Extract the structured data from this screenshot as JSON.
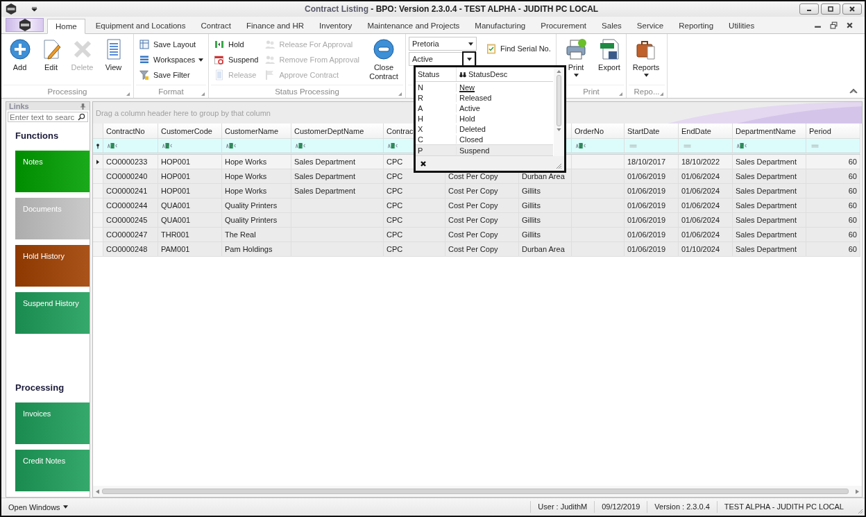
{
  "window": {
    "document_title": "Contract Listing",
    "app_title": "- BPO: Version 2.3.0.4 - TEST ALPHA - JUDITH PC LOCAL"
  },
  "tabs": [
    {
      "label": "Home",
      "selected": true
    },
    {
      "label": "Equipment and Locations",
      "selected": false
    },
    {
      "label": "Contract",
      "selected": false
    },
    {
      "label": "Finance and HR",
      "selected": false
    },
    {
      "label": "Inventory",
      "selected": false
    },
    {
      "label": "Maintenance and Projects",
      "selected": false
    },
    {
      "label": "Manufacturing",
      "selected": false
    },
    {
      "label": "Procurement",
      "selected": false
    },
    {
      "label": "Sales",
      "selected": false
    },
    {
      "label": "Service",
      "selected": false
    },
    {
      "label": "Reporting",
      "selected": false
    },
    {
      "label": "Utilities",
      "selected": false
    }
  ],
  "ribbon": {
    "groups": [
      {
        "label": "Processing",
        "items": [
          {
            "kind": "large",
            "label": "Add",
            "disabled": false
          },
          {
            "kind": "large",
            "label": "Edit",
            "disabled": false
          },
          {
            "kind": "large",
            "label": "Delete",
            "disabled": true
          },
          {
            "kind": "large",
            "label": "View",
            "disabled": false
          }
        ]
      },
      {
        "label": "Format",
        "items": [
          {
            "kind": "small",
            "label": "Save Layout",
            "disabled": false
          },
          {
            "kind": "small",
            "label": "Workspaces",
            "disabled": false,
            "dropdown": true
          },
          {
            "kind": "small",
            "label": "Save Filter",
            "disabled": false
          }
        ]
      },
      {
        "label": "Status Processing",
        "items": [
          {
            "kind": "small",
            "label": "Hold",
            "disabled": false
          },
          {
            "kind": "small",
            "label": "Suspend",
            "disabled": false
          },
          {
            "kind": "small",
            "label": "Release",
            "disabled": true
          },
          {
            "kind": "small",
            "label": "Release For Approval",
            "disabled": true
          },
          {
            "kind": "small",
            "label": "Remove From Approval",
            "disabled": true
          },
          {
            "kind": "small",
            "label": "Approve Contract",
            "disabled": true
          },
          {
            "kind": "large",
            "label": "Close Contract",
            "disabled": false
          }
        ]
      },
      {
        "items": [
          {
            "kind": "combo",
            "value": "Pretoria",
            "open": false
          },
          {
            "kind": "combo",
            "value": "Active",
            "open": true
          },
          {
            "kind": "small",
            "label": "Find Serial No."
          }
        ]
      },
      {
        "label": "Print",
        "items": [
          {
            "kind": "large",
            "label": "Print",
            "disabled": false,
            "dropdown": true
          },
          {
            "kind": "large",
            "label": "Export",
            "disabled": false
          }
        ]
      },
      {
        "label": "Repo...",
        "items": [
          {
            "kind": "large",
            "label": "Reports",
            "disabled": false,
            "dropdown": true
          }
        ]
      }
    ]
  },
  "status_dropdown": {
    "columns": [
      "Status",
      "StatusDesc"
    ],
    "rows": [
      {
        "code": "N",
        "desc": "New",
        "selected": false,
        "hovered": true
      },
      {
        "code": "R",
        "desc": "Released",
        "selected": false,
        "hovered": false
      },
      {
        "code": "A",
        "desc": "Active",
        "selected": false,
        "hovered": false
      },
      {
        "code": "H",
        "desc": "Hold",
        "selected": false,
        "hovered": false
      },
      {
        "code": "X",
        "desc": "Deleted",
        "selected": false,
        "hovered": false
      },
      {
        "code": "C",
        "desc": "Closed",
        "selected": false,
        "hovered": false
      },
      {
        "code": "P",
        "desc": "Suspend",
        "selected": true,
        "hovered": false
      }
    ]
  },
  "sidebar": {
    "title": "Links",
    "search_placeholder": "Enter text to searc",
    "sections": [
      {
        "heading": "Functions",
        "tiles": [
          {
            "label": "Notes",
            "color": "#00a000"
          },
          {
            "label": "Documents",
            "color": "#c4c4c4"
          },
          {
            "label": "Hold History",
            "color": "#a04000"
          },
          {
            "label": "Suspend History",
            "color": "#1e9e5a"
          }
        ]
      },
      {
        "heading": "Processing",
        "tiles": [
          {
            "label": "Invoices",
            "color": "#1e9e5a"
          },
          {
            "label": "Credit Notes",
            "color": "#1e9e5a"
          }
        ]
      }
    ]
  },
  "grid": {
    "group_panel_hint": "Drag a column header here to group by that column",
    "columns": [
      {
        "header": "ContractNo",
        "kind": "text"
      },
      {
        "header": "CustomerCode",
        "kind": "text"
      },
      {
        "header": "CustomerName",
        "kind": "text"
      },
      {
        "header": "CustomerDeptName",
        "kind": "text"
      },
      {
        "header": "Contrac",
        "kind": "text"
      },
      {},
      {},
      {
        "header": "OrderNo",
        "kind": "text"
      },
      {
        "header": "StartDate",
        "kind": "date"
      },
      {
        "header": "EndDate",
        "kind": "date"
      },
      {
        "header": "DepartmentName",
        "kind": "text"
      },
      {
        "header": "Period",
        "kind": "number"
      }
    ],
    "rows": [
      {
        "selected": true,
        "cells": [
          "CO0000233",
          "HOP001",
          "Hope Works",
          "Sales Department",
          "CPC",
          null,
          null,
          null,
          "18/10/2017",
          "18/10/2022",
          "Sales Department",
          "60"
        ]
      },
      {
        "selected": false,
        "cells": [
          "CO0000240",
          "HOP001",
          "Hope Works",
          "Sales Department",
          "CPC",
          "Cost Per Copy",
          "Durban Area",
          null,
          "01/06/2019",
          "01/06/2024",
          "Sales Department",
          "60"
        ]
      },
      {
        "selected": false,
        "cells": [
          "CO0000241",
          "HOP001",
          "Hope Works",
          "Sales Department",
          "CPC",
          "Cost Per Copy",
          "Gillits",
          null,
          "01/06/2019",
          "01/06/2024",
          "Sales Department",
          "60"
        ]
      },
      {
        "selected": false,
        "cells": [
          "CO0000244",
          "QUA001",
          "Quality Printers",
          null,
          "CPC",
          "Cost Per Copy",
          "Gillits",
          null,
          "01/06/2019",
          "01/06/2024",
          "Sales Department",
          "60"
        ]
      },
      {
        "selected": false,
        "cells": [
          "CO0000245",
          "QUA001",
          "Quality Printers",
          null,
          "CPC",
          "Cost Per Copy",
          "Gillits",
          null,
          "01/06/2019",
          "01/06/2024",
          "Sales Department",
          "60"
        ]
      },
      {
        "selected": false,
        "cells": [
          "CO0000247",
          "THR001",
          "The Real",
          null,
          "CPC",
          "Cost Per Copy",
          "Gillits",
          null,
          "01/06/2019",
          "01/06/2024",
          "Sales Department",
          "60"
        ]
      },
      {
        "selected": false,
        "cells": [
          "CO0000248",
          "PAM001",
          "Pam Holdings",
          null,
          "CPC",
          "Cost Per Copy",
          "Durban Area",
          null,
          "01/06/2019",
          "01/10/2024",
          "Sales Department",
          "60"
        ]
      }
    ]
  },
  "status_bar": {
    "open_windows": "Open Windows",
    "panels": [
      "User : JudithM",
      "09/12/2019",
      "Version : 2.3.0.4",
      "TEST ALPHA - JUDITH PC LOCAL"
    ]
  }
}
